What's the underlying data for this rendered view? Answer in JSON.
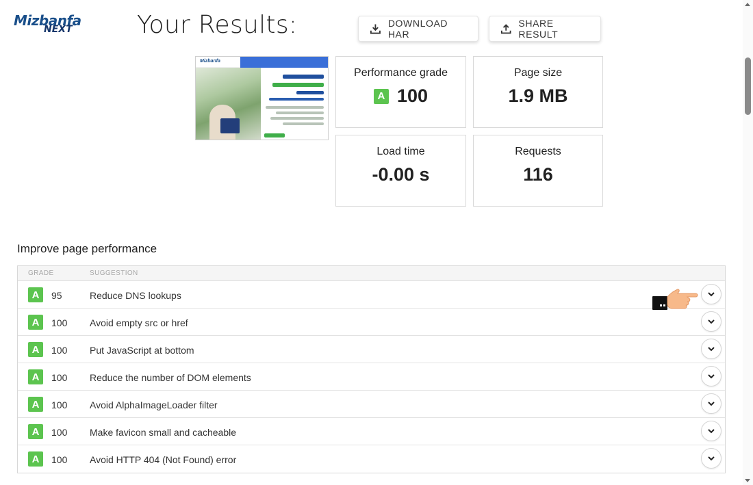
{
  "brand": {
    "logo_top": "Mizbanfa",
    "logo_bottom": "NEXT"
  },
  "header": {
    "title": "Your Results:",
    "download_label": "DOWNLOAD HAR",
    "share_label": "SHARE RESULT"
  },
  "summary": {
    "performance_label": "Performance grade",
    "performance_grade": "A",
    "performance_score": "100",
    "page_size_label": "Page size",
    "page_size_value": "1.9 MB",
    "load_time_label": "Load time",
    "load_time_value": "-0.00 s",
    "requests_label": "Requests",
    "requests_value": "116"
  },
  "improve": {
    "title": "Improve page performance",
    "col_grade": "GRADE",
    "col_suggestion": "SUGGESTION",
    "rows": [
      {
        "grade": "A",
        "score": "95",
        "suggestion": "Reduce DNS lookups"
      },
      {
        "grade": "A",
        "score": "100",
        "suggestion": "Avoid empty src or href"
      },
      {
        "grade": "A",
        "score": "100",
        "suggestion": "Put JavaScript at bottom"
      },
      {
        "grade": "A",
        "score": "100",
        "suggestion": "Reduce the number of DOM elements"
      },
      {
        "grade": "A",
        "score": "100",
        "suggestion": "Avoid AlphaImageLoader filter"
      },
      {
        "grade": "A",
        "score": "100",
        "suggestion": "Make favicon small and cacheable"
      },
      {
        "grade": "A",
        "score": "100",
        "suggestion": "Avoid HTTP 404 (Not Found) error"
      }
    ]
  },
  "colors": {
    "grade_a": "#5cc44f",
    "brand_blue": "#1a4f8a"
  },
  "icons": {
    "download": "download-icon",
    "share": "share-icon",
    "expand": "chevron-down-icon",
    "pointer": "pointing-hand-icon"
  }
}
